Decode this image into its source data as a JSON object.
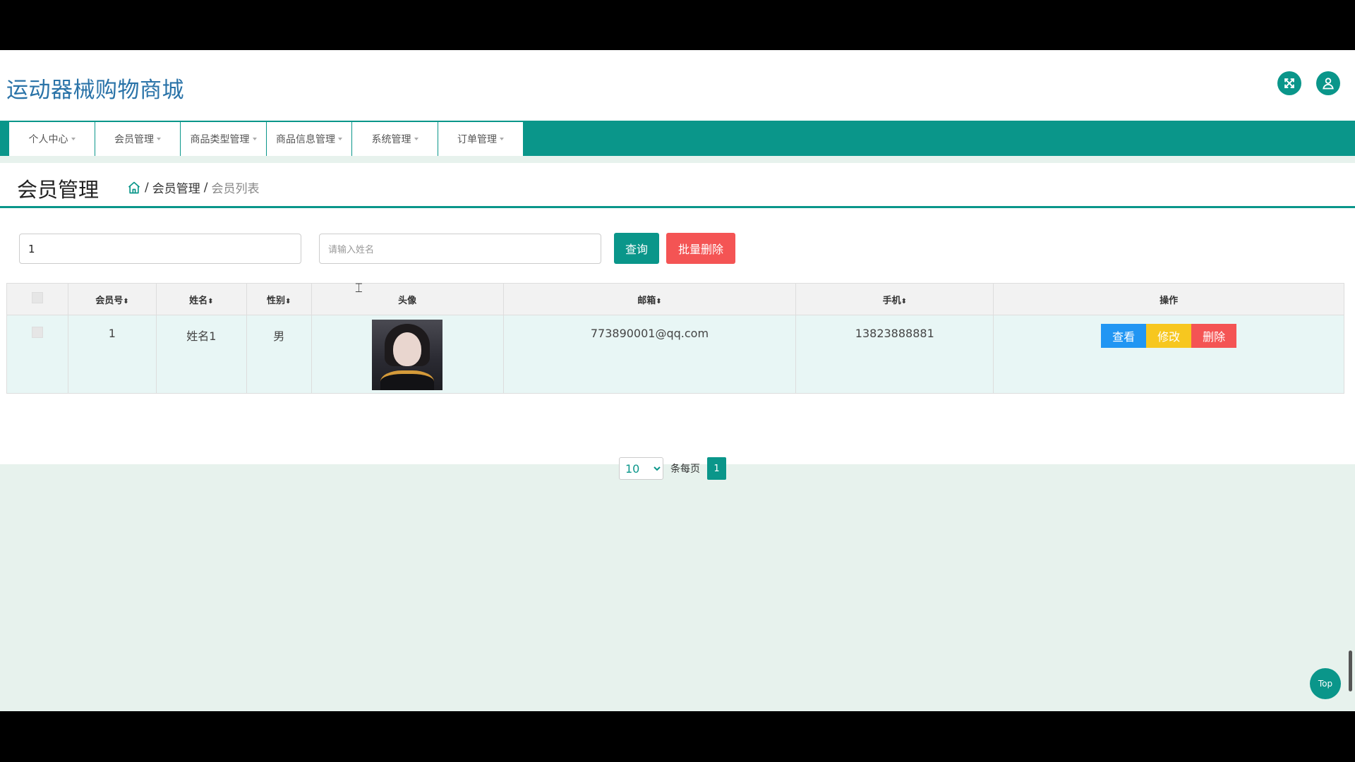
{
  "app": {
    "title": "运动器械购物商城"
  },
  "nav": {
    "items": [
      {
        "label": "个人中心"
      },
      {
        "label": "会员管理"
      },
      {
        "label": "商品类型管理"
      },
      {
        "label": "商品信息管理"
      },
      {
        "label": "系统管理"
      },
      {
        "label": "订单管理"
      }
    ]
  },
  "page": {
    "title": "会员管理",
    "breadcrumb": {
      "sep": "/",
      "parent": "会员管理",
      "current": "会员列表"
    }
  },
  "search": {
    "field1_value": "1",
    "name_placeholder": "请输入姓名",
    "query_label": "查询",
    "batch_delete_label": "批量删除"
  },
  "table": {
    "headers": [
      "会员号",
      "姓名",
      "性别",
      "头像",
      "邮箱",
      "手机",
      "操作"
    ],
    "sort_mark": "⬍",
    "rows": [
      {
        "id": "1",
        "name": "姓名1",
        "gender": "男",
        "email": "773890001@qq.com",
        "phone": "13823888881"
      }
    ],
    "actions": {
      "view": "查看",
      "edit": "修改",
      "delete": "删除"
    }
  },
  "pagination": {
    "page_size": "10",
    "page_size_options": [
      "10"
    ],
    "per_page_label": "条每页",
    "current_page": "1"
  },
  "top_button": {
    "label": "Top"
  },
  "colors": {
    "primary": "#0a968a",
    "title_blue": "#2a73a8",
    "danger": "#f45454",
    "info": "#2196f3",
    "warning": "#f7c71f",
    "page_bg": "#e7f2ed",
    "row_bg": "#e8f6f5"
  }
}
